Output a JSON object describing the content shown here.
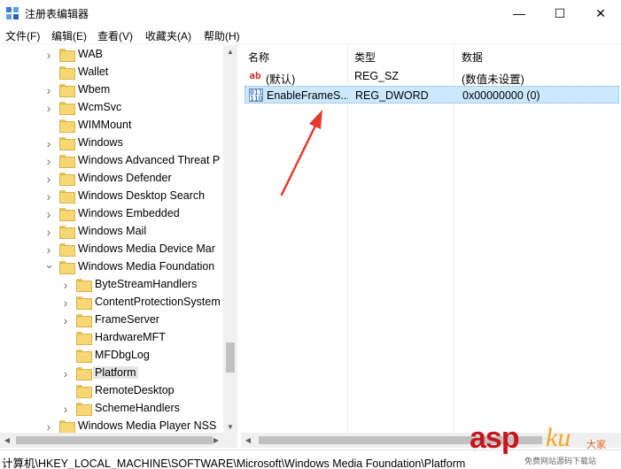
{
  "window": {
    "title": "注册表编辑器",
    "minimize": "—",
    "maximize": "☐",
    "close": "✕"
  },
  "menu": [
    "文件(F)",
    "编辑(E)",
    "查看(V)",
    "收藏夹(A)",
    "帮助(H)"
  ],
  "tree": [
    {
      "label": "WAB",
      "level": 0,
      "expander": "collapsed",
      "selected": false
    },
    {
      "label": "Wallet",
      "level": 0,
      "expander": "none",
      "selected": false
    },
    {
      "label": "Wbem",
      "level": 0,
      "expander": "collapsed",
      "selected": false
    },
    {
      "label": "WcmSvc",
      "level": 0,
      "expander": "collapsed",
      "selected": false
    },
    {
      "label": "WIMMount",
      "level": 0,
      "expander": "none",
      "selected": false
    },
    {
      "label": "Windows",
      "level": 0,
      "expander": "collapsed",
      "selected": false
    },
    {
      "label": "Windows Advanced Threat P",
      "level": 0,
      "expander": "collapsed",
      "selected": false
    },
    {
      "label": "Windows Defender",
      "level": 0,
      "expander": "collapsed",
      "selected": false
    },
    {
      "label": "Windows Desktop Search",
      "level": 0,
      "expander": "collapsed",
      "selected": false
    },
    {
      "label": "Windows Embedded",
      "level": 0,
      "expander": "collapsed",
      "selected": false
    },
    {
      "label": "Windows Mail",
      "level": 0,
      "expander": "collapsed",
      "selected": false
    },
    {
      "label": "Windows Media Device Mar",
      "level": 0,
      "expander": "collapsed",
      "selected": false
    },
    {
      "label": "Windows Media Foundation",
      "level": 0,
      "expander": "expanded",
      "selected": false
    },
    {
      "label": "ByteStreamHandlers",
      "level": 1,
      "expander": "collapsed",
      "selected": false
    },
    {
      "label": "ContentProtectionSystem",
      "level": 1,
      "expander": "collapsed",
      "selected": false
    },
    {
      "label": "FrameServer",
      "level": 1,
      "expander": "collapsed",
      "selected": false
    },
    {
      "label": "HardwareMFT",
      "level": 1,
      "expander": "none",
      "selected": false
    },
    {
      "label": "MFDbgLog",
      "level": 1,
      "expander": "none",
      "selected": false
    },
    {
      "label": "Platform",
      "level": 1,
      "expander": "collapsed",
      "selected": true
    },
    {
      "label": "RemoteDesktop",
      "level": 1,
      "expander": "none",
      "selected": false
    },
    {
      "label": "SchemeHandlers",
      "level": 1,
      "expander": "collapsed",
      "selected": false
    },
    {
      "label": "Windows Media Player NSS",
      "level": 0,
      "expander": "collapsed",
      "selected": false
    }
  ],
  "values": {
    "headers": {
      "name": "名称",
      "type": "类型",
      "data": "数据"
    },
    "rows": [
      {
        "icon": "string-value-icon",
        "icon_text": "ab",
        "name": "(默认)",
        "type": "REG_SZ",
        "data": "(数值未设置)",
        "selected": false
      },
      {
        "icon": "binary-value-icon",
        "icon_text": "011\n110",
        "name": "EnableFrameS...",
        "type": "REG_DWORD",
        "data": "0x00000000 (0)",
        "selected": true
      }
    ]
  },
  "status": {
    "path": "计算机\\HKEY_LOCAL_MACHINE\\SOFTWARE\\Microsoft\\Windows Media Foundation\\Platform"
  },
  "watermark": {
    "asp": "asp",
    "ku": "ku",
    "cn": "大家",
    "sub": "免费网站源码下载站"
  },
  "colors": {
    "accent_selection": "#cce8ff",
    "annotation_arrow": "#e5392f",
    "folder": "#f7d774"
  }
}
